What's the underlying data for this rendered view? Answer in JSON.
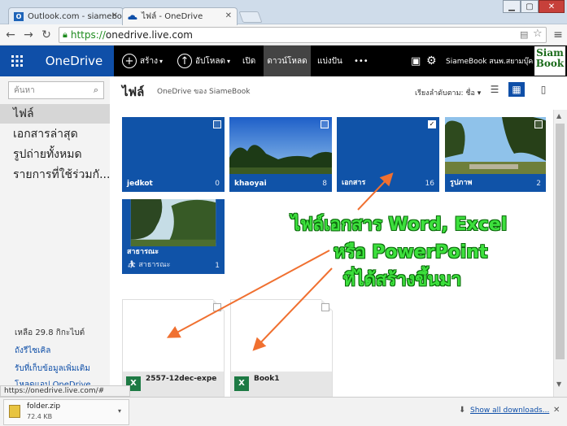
{
  "browser": {
    "tabs": [
      {
        "title": "Outlook.com - siameboo",
        "favicon": "outlook-icon"
      },
      {
        "title": "ไฟล์ - OneDrive",
        "favicon": "onedrive-icon",
        "active": true
      }
    ],
    "url_scheme": "https://",
    "url_rest": "onedrive.live.com",
    "status_url": "https://onedrive.live.com/#"
  },
  "header": {
    "brand": "OneDrive",
    "commands": {
      "create": "สร้าง",
      "upload": "อัปโหลด",
      "open": "เปิด",
      "download": "ดาวน์โหลด",
      "share": "แบ่งปัน",
      "more": "•••"
    },
    "user": "SiameBook สนพ.สยามบุ๊ค",
    "logo_text": "Siam Book"
  },
  "sidebar": {
    "search_placeholder": "ค้นหา",
    "items": [
      {
        "label": "ไฟล์"
      },
      {
        "label": "เอกสารล่าสุด"
      },
      {
        "label": "รูปถ่ายทั้งหมด"
      },
      {
        "label": "รายการที่ใช้ร่วมกั..."
      }
    ],
    "storage": "เหลือ 29.8 กิกะไบต์",
    "recycle": "ถังรีไซเคิล",
    "get_more": "รับที่เก็บข้อมูลเพิ่มเติม",
    "download_app": "โหลดแอป OneDrive"
  },
  "main": {
    "title": "ไฟล์",
    "subtitle": "OneDrive ของ SiameBook",
    "sort_label": "เรียงลำดับตาม: ชื่อ ▾",
    "folders": [
      {
        "name": "jedkot",
        "count": "0",
        "checked": false
      },
      {
        "name": "khaoyai",
        "count": "8",
        "checked": false
      },
      {
        "name": "เอกสาร",
        "count": "16",
        "checked": true
      },
      {
        "name": "รูปภาพ",
        "count": "2",
        "checked": false
      },
      {
        "name": "สาธารณะ",
        "count": "1",
        "sub": "สาธารณะ",
        "checked": false
      }
    ],
    "files": [
      {
        "name": "2557-12dec-expe",
        "type": "xlsx"
      },
      {
        "name": "Book1",
        "type": "xlsx"
      }
    ]
  },
  "annotation": {
    "line1": "ไฟล์เอกสาร Word, Excel",
    "line2": "หรือ PowerPoint",
    "line3": "ที่ได้สร้างขึ้นมา",
    "color": "#3de03d"
  },
  "downloads": {
    "file_name": "folder.zip",
    "file_size": "72.4 KB",
    "show_all": "Show all downloads..."
  }
}
